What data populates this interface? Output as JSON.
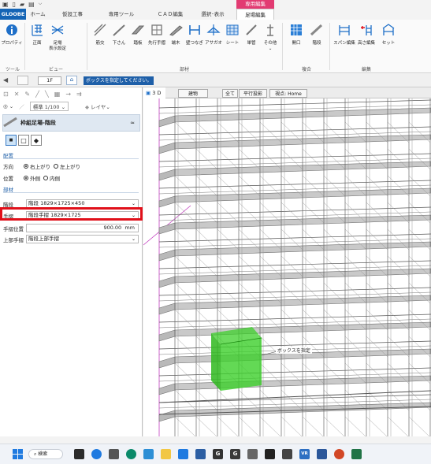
{
  "ribbon_tabs": {
    "app": "GLOOBE",
    "home": "ホーム",
    "temp": "仮設工事",
    "special": "専用ツール",
    "cad": "ＣＡＤ編集",
    "select": "選択･表示",
    "scaffold": "足場編集",
    "context_group": "専用編集"
  },
  "ribbon": {
    "property": "プロパティ",
    "front": "正面",
    "scaffold_view_1": "足場",
    "scaffold_view_2": "表示設定",
    "brace": "筋交",
    "shitasan": "下さん",
    "plank": "踏板",
    "advance_rail": "先行手摺",
    "end_stop": "端木",
    "wall_tie": "壁つなぎ",
    "asagao": "アサガオ",
    "sheet": "シート",
    "single_pipe": "単管",
    "other": "その他",
    "opening": "開口",
    "stairs": "階段",
    "span_edit": "スパン編集",
    "height_edit": "高さ編集",
    "set": "セット",
    "group_tool": "ツール",
    "group_view": "ビュー",
    "group_parts": "部材",
    "group_composite": "複合",
    "group_edit": "編集"
  },
  "cmdbar": {
    "floor": "1F",
    "prompt": "ボックスを指定してください。"
  },
  "toolbar2": {
    "scale": "標準 1/100",
    "layer": "レイヤ"
  },
  "panel": {
    "title": "枠組足場-階段",
    "section_layout": "配置",
    "direction_label": "方向",
    "direction_opt1": "右上がり",
    "direction_opt2": "左上がり",
    "position_label": "位置",
    "position_opt1": "外側",
    "position_opt2": "内側",
    "section_parts": "部材",
    "stairs_label": "階段",
    "stairs_value": "階段 1829×1725×450",
    "handrail_label": "手摺",
    "handrail_value": "階段手摺 1829×1725",
    "handrail_pos_label": "手摺位置",
    "handrail_pos_value": "900.00",
    "handrail_pos_unit": "mm",
    "upper_rail_label": "上部手摺",
    "upper_rail_value": "階段上部手摺"
  },
  "viewport": {
    "view_mode": "3 D",
    "tab_building": "建物",
    "tab_all": "全て",
    "tab_parallel": "平行投影",
    "tab_viewpoint": "視点: Home",
    "box_label": "ボックスを指定"
  },
  "taskbar": {
    "search": "検索",
    "g1": "G",
    "g2": "G",
    "vr": "VR"
  },
  "colors": {
    "accent_blue": "#1464b5",
    "context_pink": "#e23b72",
    "highlight_red": "#e0101a",
    "box_green": "#3ccf2a"
  }
}
